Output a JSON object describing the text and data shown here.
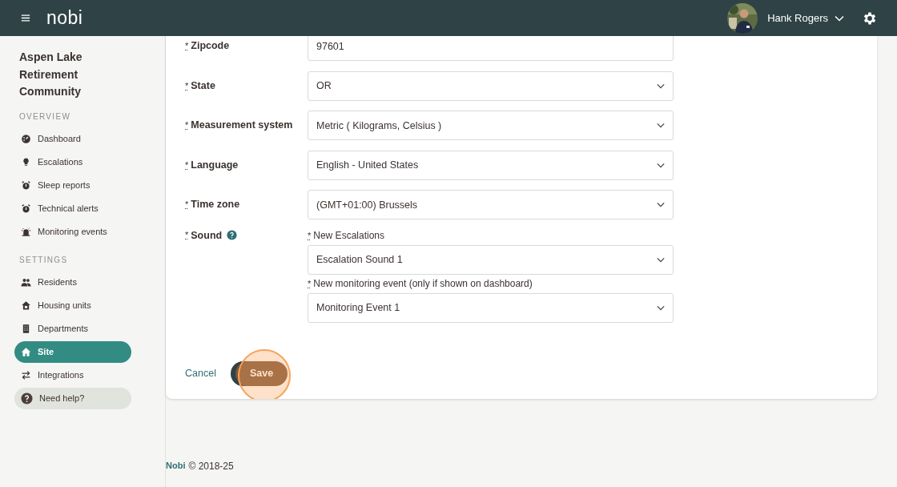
{
  "header": {
    "logo": "nobi",
    "user": {
      "name": "Hank Rogers"
    }
  },
  "sidebar": {
    "site_name": "Aspen Lake Retirement Community",
    "sections": [
      {
        "title": "OVERVIEW",
        "items": [
          {
            "label": "Dashboard",
            "selected": false
          },
          {
            "label": "Escalations",
            "selected": false
          },
          {
            "label": "Sleep reports",
            "selected": false
          },
          {
            "label": "Technical alerts",
            "selected": false
          },
          {
            "label": "Monitoring events",
            "selected": false
          }
        ]
      },
      {
        "title": "SETTINGS",
        "items": [
          {
            "label": "Residents",
            "selected": false
          },
          {
            "label": "Housing units",
            "selected": false
          },
          {
            "label": "Departments",
            "selected": false
          },
          {
            "label": "Site",
            "selected": true
          },
          {
            "label": "Integrations",
            "selected": false
          }
        ]
      }
    ],
    "help": {
      "label": "Need help?"
    }
  },
  "form": {
    "fields": [
      {
        "kind": "text",
        "marker": "*",
        "label": "Zipcode",
        "value": "97601"
      },
      {
        "kind": "select",
        "marker": "*",
        "label": "State",
        "value": "OR"
      },
      {
        "kind": "select",
        "marker": "*",
        "label": "Measurement system",
        "value": "Metric ( Kilograms, Celsius )"
      },
      {
        "kind": "select",
        "marker": "*",
        "label": "Language",
        "value": "English - United States"
      },
      {
        "kind": "select",
        "marker": "*",
        "label": "Time zone",
        "value": "(GMT+01:00) Brussels"
      },
      {
        "kind": "group",
        "marker": "*",
        "label": "Sound",
        "help": true,
        "subfields": [
          {
            "marker": "*",
            "label": "New Escalations",
            "value": "Escalation Sound 1"
          },
          {
            "marker": "*",
            "label": "New monitoring event (only if shown on dashboard)",
            "value": "Monitoring Event 1"
          }
        ]
      }
    ],
    "cancel": "Cancel",
    "save": "Save",
    "save_highlighted": true
  },
  "footer": {
    "brand": "Nobi",
    "text": "© 2018-25"
  }
}
